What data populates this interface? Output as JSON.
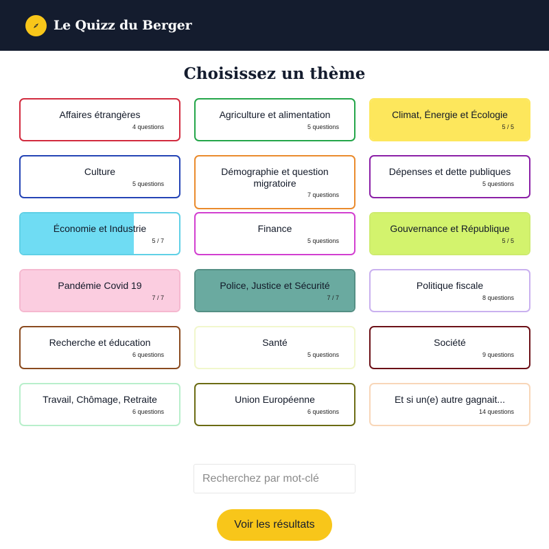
{
  "header": {
    "brand": "Le Quizz du Berger",
    "logo_icon": "compass-icon"
  },
  "page": {
    "title": "Choisissez un thème"
  },
  "themes": [
    {
      "label": "Affaires étrangères",
      "count": "4 questions",
      "color": "#d1293d",
      "progress": 0
    },
    {
      "label": "Agriculture et alimentation",
      "count": "5 questions",
      "color": "#22a548",
      "progress": 0
    },
    {
      "label": "Climat, Énergie et Écologie",
      "count": "5 / 5",
      "color": "#fde75c",
      "fill": "#fde75c",
      "progress": 1
    },
    {
      "label": "Culture",
      "count": "5 questions",
      "color": "#2343b5",
      "progress": 0
    },
    {
      "label": "Démographie et question migratoire",
      "count": "7 questions",
      "color": "#ea8a2b",
      "progress": 0
    },
    {
      "label": "Dépenses et dette publiques",
      "count": "5 questions",
      "color": "#8a1ea6",
      "progress": 0
    },
    {
      "label": "Économie et Industrie",
      "count": "5 / 7",
      "color": "#5fd0e6",
      "fill": "#6fdcf3",
      "progress": 0.714
    },
    {
      "label": "Finance",
      "count": "5 questions",
      "color": "#d23ed0",
      "progress": 0
    },
    {
      "label": "Gouvernance et République",
      "count": "5 / 5",
      "color": "#cdeb6c",
      "fill": "#d3f36d",
      "progress": 1
    },
    {
      "label": "Pandémie Covid 19",
      "count": "7 / 7",
      "color": "#f5b8cf",
      "fill": "#fbcde0",
      "progress": 1
    },
    {
      "label": "Police, Justice et Sécurité",
      "count": "7 / 7",
      "color": "#548f84",
      "fill": "#6aaaa0",
      "progress": 1
    },
    {
      "label": "Politique fiscale",
      "count": "8 questions",
      "color": "#c9b0ef",
      "progress": 0
    },
    {
      "label": "Recherche et éducation",
      "count": "6 questions",
      "color": "#8a4a1e",
      "progress": 0
    },
    {
      "label": "Santé",
      "count": "5 questions",
      "color": "#f1f7cc",
      "progress": 0
    },
    {
      "label": "Société",
      "count": "9 questions",
      "color": "#6b0f16",
      "progress": 0
    },
    {
      "label": "Travail, Chômage, Retraite",
      "count": "6 questions",
      "color": "#b8efcb",
      "progress": 0
    },
    {
      "label": "Union Européenne",
      "count": "6 questions",
      "color": "#6b6b12",
      "progress": 0
    },
    {
      "label": "Et si un(e) autre gagnait...",
      "count": "14 questions",
      "color": "#f8d6b8",
      "progress": 0
    }
  ],
  "search": {
    "placeholder": "Recherchez par mot-clé",
    "value": ""
  },
  "actions": {
    "results_label": "Voir les résultats"
  }
}
